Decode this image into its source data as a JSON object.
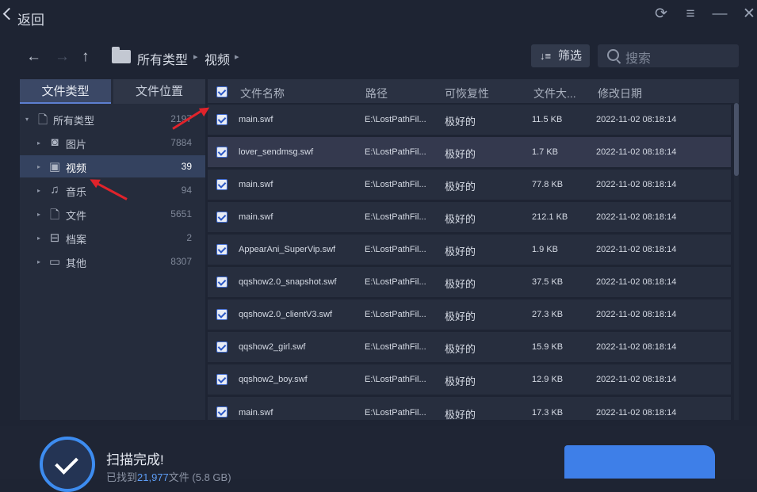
{
  "titlebar": {
    "back_label": "返回",
    "refresh_icon": "refresh-icon",
    "menu_icon": "hamburger-menu-icon",
    "minimize_icon": "minimize-icon",
    "close_icon": "close-icon"
  },
  "nav": {
    "back_icon": "arrow-left-icon",
    "forward_icon": "arrow-right-icon",
    "up_icon": "arrow-up-icon",
    "breadcrumb": [
      "所有类型",
      "视频"
    ],
    "filter_label": "筛选",
    "search_placeholder": "搜索"
  },
  "sidebar": {
    "tabs": [
      {
        "label": "文件类型",
        "active": true
      },
      {
        "label": "文件位置",
        "active": false
      }
    ],
    "root": {
      "label": "所有类型",
      "count": "2197",
      "icon": "document-icon"
    },
    "items": [
      {
        "label": "图片",
        "count": "7884",
        "icon": "camera-icon"
      },
      {
        "label": "视频",
        "count": "39",
        "icon": "video-icon",
        "selected": true
      },
      {
        "label": "音乐",
        "count": "94",
        "icon": "music-icon"
      },
      {
        "label": "文件",
        "count": "5651",
        "icon": "file-icon"
      },
      {
        "label": "档案",
        "count": "2",
        "icon": "archive-icon"
      },
      {
        "label": "其他",
        "count": "8307",
        "icon": "folder-icon"
      }
    ]
  },
  "table": {
    "columns": [
      "文件名称",
      "路径",
      "可恢复性",
      "文件大...",
      "修改日期"
    ],
    "rows": [
      {
        "name": "main.swf",
        "path": "E:\\LostPathFil...",
        "quality": "极好的",
        "size": "11.5 KB",
        "date": "2022-11-02 08:18:14",
        "checked": true
      },
      {
        "name": "lover_sendmsg.swf",
        "path": "E:\\LostPathFil...",
        "quality": "极好的",
        "size": "1.7 KB",
        "date": "2022-11-02 08:18:14",
        "checked": true
      },
      {
        "name": "main.swf",
        "path": "E:\\LostPathFil...",
        "quality": "极好的",
        "size": "77.8 KB",
        "date": "2022-11-02 08:18:14",
        "checked": true
      },
      {
        "name": "main.swf",
        "path": "E:\\LostPathFil...",
        "quality": "极好的",
        "size": "212.1 KB",
        "date": "2022-11-02 08:18:14",
        "checked": true
      },
      {
        "name": "AppearAni_SuperVip.swf",
        "path": "E:\\LostPathFil...",
        "quality": "极好的",
        "size": "1.9 KB",
        "date": "2022-11-02 08:18:14",
        "checked": true
      },
      {
        "name": "qqshow2.0_snapshot.swf",
        "path": "E:\\LostPathFil...",
        "quality": "极好的",
        "size": "37.5 KB",
        "date": "2022-11-02 08:18:14",
        "checked": true
      },
      {
        "name": "qqshow2.0_clientV3.swf",
        "path": "E:\\LostPathFil...",
        "quality": "极好的",
        "size": "27.3 KB",
        "date": "2022-11-02 08:18:14",
        "checked": true
      },
      {
        "name": "qqshow2_girl.swf",
        "path": "E:\\LostPathFil...",
        "quality": "极好的",
        "size": "15.9 KB",
        "date": "2022-11-02 08:18:14",
        "checked": true
      },
      {
        "name": "qqshow2_boy.swf",
        "path": "E:\\LostPathFil...",
        "quality": "极好的",
        "size": "12.9 KB",
        "date": "2022-11-02 08:18:14",
        "checked": true
      },
      {
        "name": "main.swf",
        "path": "E:\\LostPathFil...",
        "quality": "极好的",
        "size": "17.3 KB",
        "date": "2022-11-02 08:18:14",
        "checked": true
      }
    ]
  },
  "footer": {
    "status_icon": "check-circle-icon",
    "title": "扫描完成!",
    "found_prefix": "已找到",
    "found_count": "21,977",
    "found_suffix": "文件 (5.8 GB)"
  },
  "colors": {
    "background": "#1e2433",
    "accent": "#3d8cf0",
    "annotation_arrow": "#e0232b"
  }
}
